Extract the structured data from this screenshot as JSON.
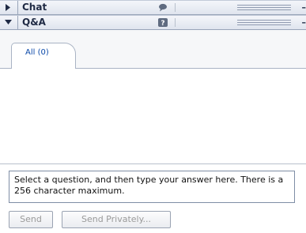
{
  "panels": {
    "chat": {
      "title": "Chat",
      "icon": "speech-bubble-icon",
      "state": "collapsed"
    },
    "qa": {
      "title": "Q&A",
      "icon": "question-mark-icon",
      "state": "expanded"
    }
  },
  "header_dash": "–",
  "tabs": [
    {
      "label": "All (0)"
    }
  ],
  "answer": {
    "placeholder": "Select a question, and then type your answer here. There is a 256 character maximum."
  },
  "buttons": {
    "send": "Send",
    "send_privately": "Send Privately..."
  }
}
